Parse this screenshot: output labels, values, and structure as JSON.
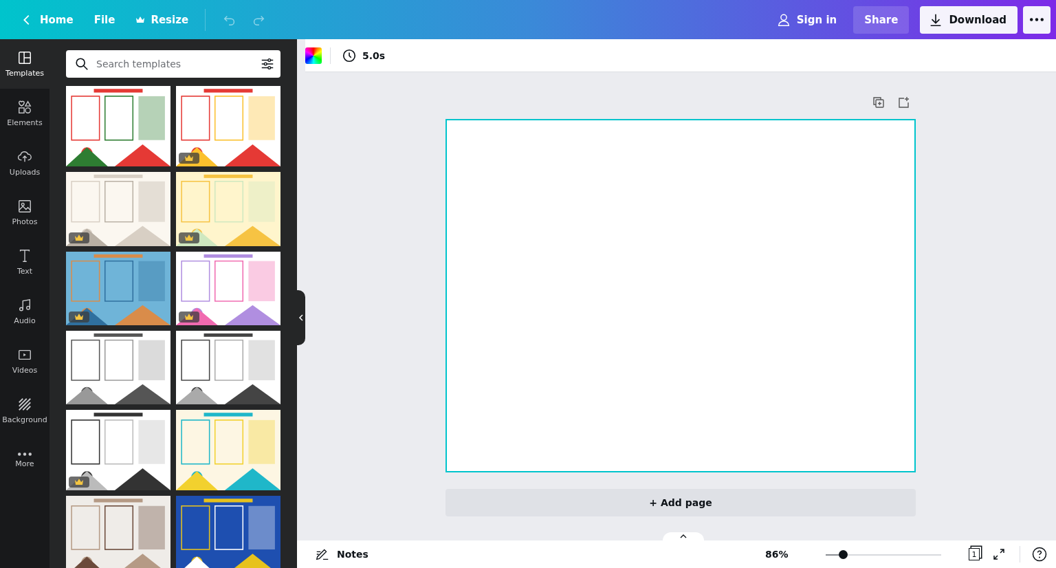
{
  "topbar": {
    "home": "Home",
    "file": "File",
    "resize": "Resize",
    "sign_in": "Sign in",
    "share": "Share",
    "download": "Download"
  },
  "sidebar": {
    "items": [
      {
        "label": "Templates",
        "selected": true
      },
      {
        "label": "Elements",
        "selected": false
      },
      {
        "label": "Uploads",
        "selected": false
      },
      {
        "label": "Photos",
        "selected": false
      },
      {
        "label": "Text",
        "selected": false
      },
      {
        "label": "Audio",
        "selected": false
      },
      {
        "label": "Videos",
        "selected": false
      },
      {
        "label": "Background",
        "selected": false
      },
      {
        "label": "More",
        "selected": false
      }
    ]
  },
  "panel": {
    "search": {
      "placeholder": "Search templates"
    },
    "templates": [
      {
        "premium": false
      },
      {
        "premium": true
      },
      {
        "premium": true
      },
      {
        "premium": true
      },
      {
        "premium": true
      },
      {
        "premium": true
      },
      {
        "premium": false
      },
      {
        "premium": false
      },
      {
        "premium": true
      },
      {
        "premium": false
      },
      {
        "premium": false
      },
      {
        "premium": false
      }
    ]
  },
  "toolbar": {
    "duration": "5.0s"
  },
  "canvas": {
    "add_page": "+ Add page"
  },
  "footer": {
    "notes": "Notes",
    "zoom": "86%",
    "zoom_slider": {
      "level": 0.15
    },
    "page_count": "1"
  }
}
